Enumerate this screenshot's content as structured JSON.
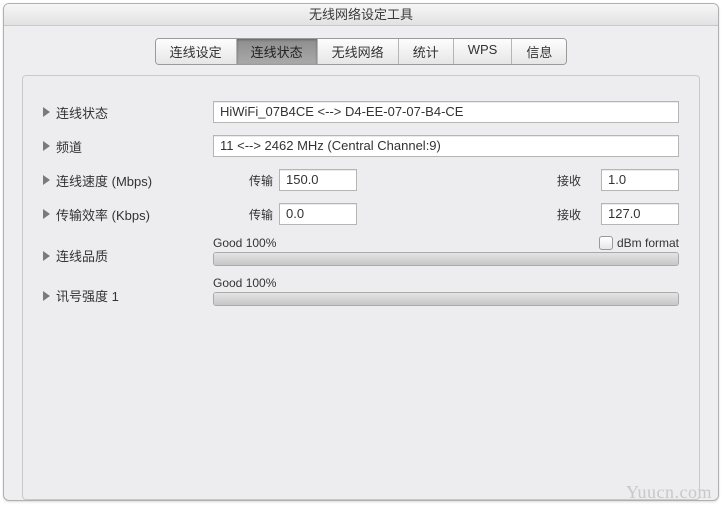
{
  "window": {
    "title": "无线网络设定工具"
  },
  "tabs": [
    {
      "label": "连线设定"
    },
    {
      "label": "连线状态"
    },
    {
      "label": "无线网络"
    },
    {
      "label": "统计"
    },
    {
      "label": "WPS"
    },
    {
      "label": "信息"
    }
  ],
  "activeTab": 1,
  "rows": {
    "status": {
      "label": "连线状态",
      "value": "HiWiFi_07B4CE <--> D4-EE-07-07-B4-CE"
    },
    "channel": {
      "label": "频道",
      "value": "11 <--> 2462 MHz (Central Channel:9)"
    },
    "speed": {
      "label": "连线速度 (Mbps)",
      "txLabel": "传输",
      "tx": "150.0",
      "rxLabel": "接收",
      "rx": "1.0"
    },
    "throughput": {
      "label": "传输效率 (Kbps)",
      "txLabel": "传输",
      "tx": "0.0",
      "rxLabel": "接收",
      "rx": "127.0"
    },
    "quality": {
      "label": "连线品质",
      "text": "Good 100%",
      "dbm_label": "dBm format"
    },
    "signal": {
      "label": "讯号强度 1",
      "text": "Good 100%"
    }
  },
  "watermark": "Yuucn.com"
}
